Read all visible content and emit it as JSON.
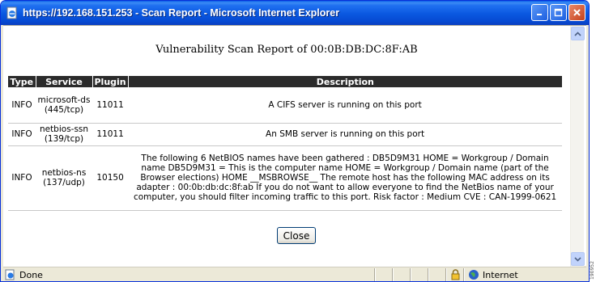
{
  "window": {
    "title": "https://192.168.151.253 - Scan Report - Microsoft Internet Explorer"
  },
  "report": {
    "title": "Vulnerability Scan Report of 00:0B:DB:DC:8F:AB",
    "columns": [
      "Type",
      "Service",
      "Plugin",
      "Description"
    ],
    "rows": [
      {
        "type": "INFO",
        "service": "microsoft-ds (445/tcp)",
        "plugin": "11011",
        "description": "A CIFS server is running on this port"
      },
      {
        "type": "INFO",
        "service": "netbios-ssn (139/tcp)",
        "plugin": "11011",
        "description": "An SMB server is running on this port"
      },
      {
        "type": "INFO",
        "service": "netbios-ns (137/udp)",
        "plugin": "10150",
        "description": "The following 6 NetBIOS names have been gathered : DB5D9M31 HOME = Workgroup / Domain name DB5D9M31 = This is the computer name HOME = Workgroup / Domain name (part of the Browser elections) HOME __MSBROWSE__ The remote host has the following MAC address on its adapter : 00:0b:db:dc:8f:ab If you do not want to allow everyone to find the NetBios name of your computer, you should filter incoming traffic to this port. Risk factor : Medium CVE : CAN-1999-0621"
      }
    ],
    "close_label": "Close"
  },
  "statusbar": {
    "status": "Done",
    "zone": "Internet"
  },
  "side_code": "190952"
}
